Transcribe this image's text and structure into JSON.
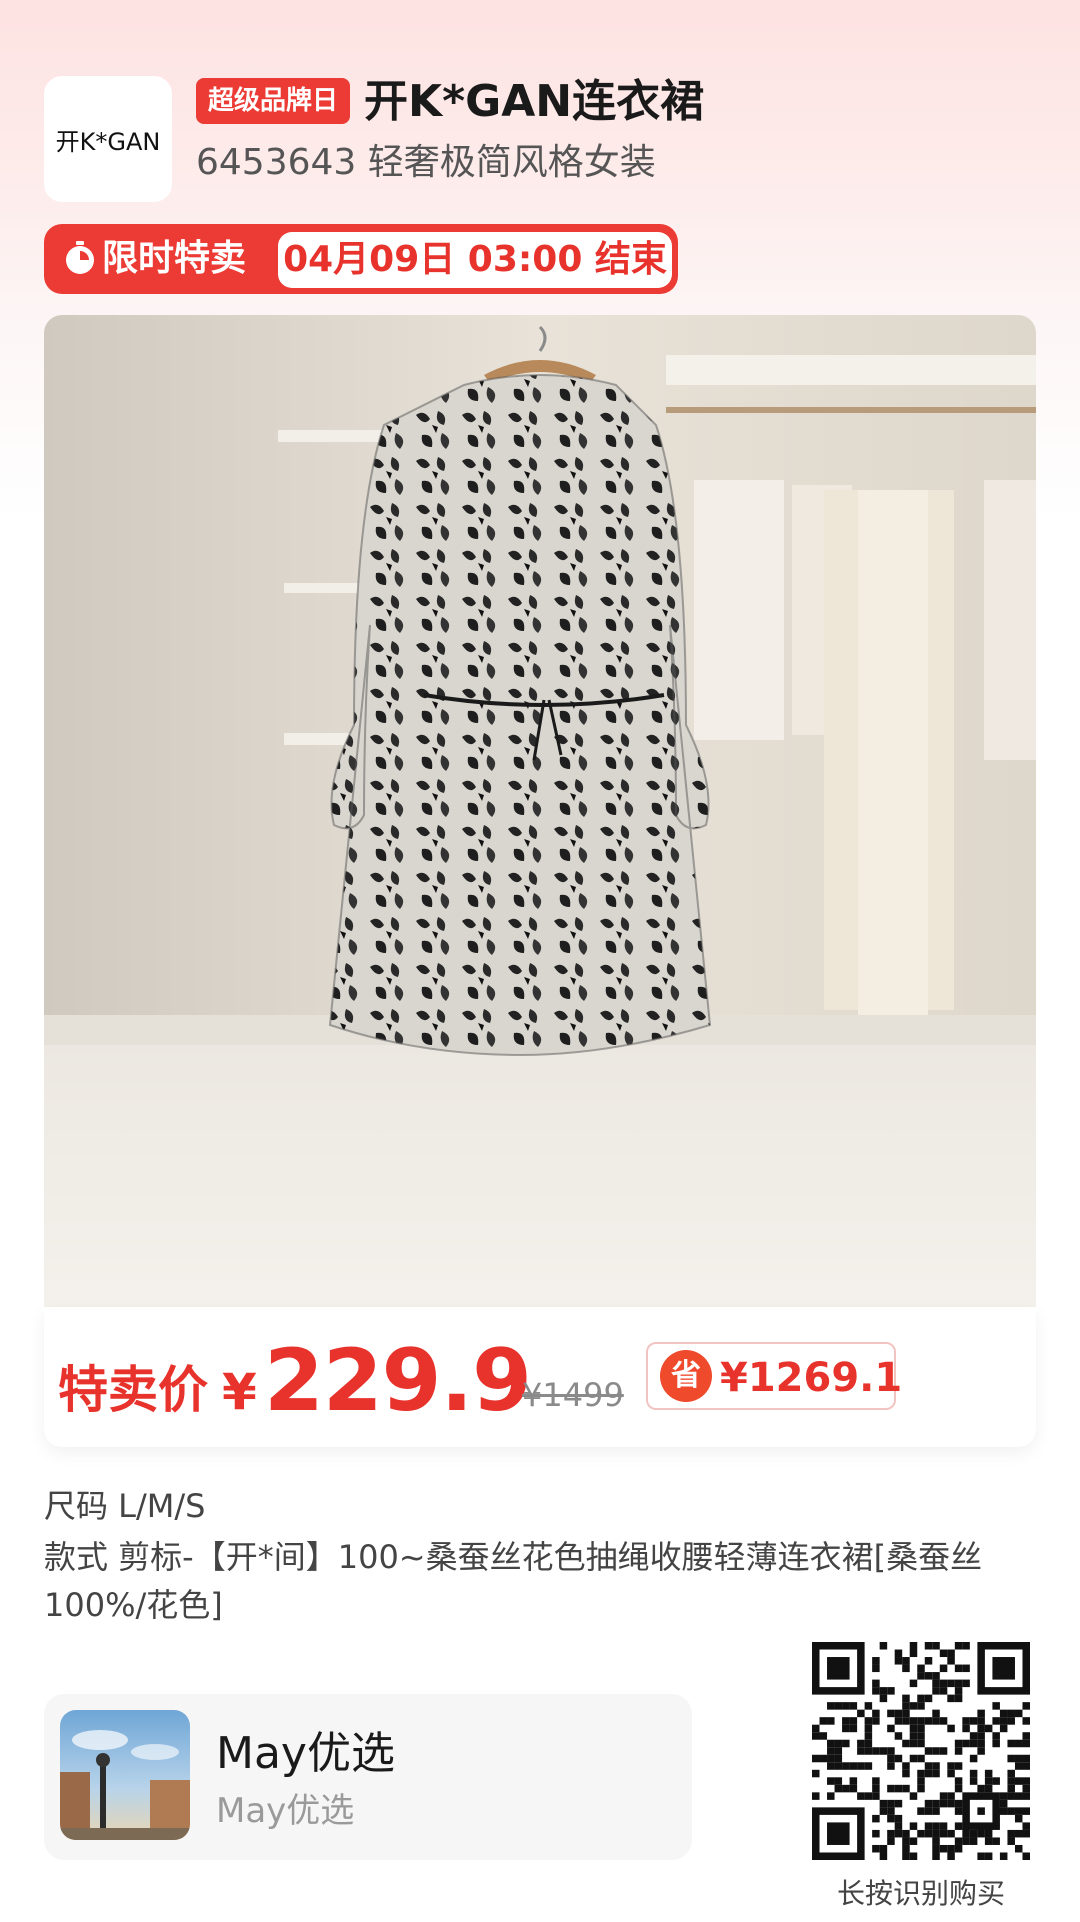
{
  "header": {
    "logo_text": "开K*GAN",
    "badge": "超级品牌日",
    "title": "开K*GAN连衣裙",
    "subtitle": "6453643 轻奢极简风格女装"
  },
  "flash_sale": {
    "label": "限时特卖",
    "end_time": "04月09日 03:00 结束",
    "icon": "stopwatch-icon"
  },
  "product_image": {
    "icon": "dress-photo",
    "alt": "patterned chiffon dress on hanger"
  },
  "price": {
    "label": "特卖价",
    "currency": "¥",
    "value": "229.9",
    "original": "¥1499",
    "save_label": "省",
    "save_amount": "¥1269.1"
  },
  "specs": {
    "size": "尺码 L/M/S",
    "style": "款式 剪标-【开*间】100~桑蚕丝花色抽绳收腰轻薄连衣裙[桑蚕丝100%/花色]"
  },
  "shop": {
    "name": "May优选",
    "subtitle": "May优选"
  },
  "qr": {
    "caption": "长按识别购买"
  },
  "colors": {
    "accent": "#e8322c",
    "badge_bg": "#ec3b35"
  }
}
